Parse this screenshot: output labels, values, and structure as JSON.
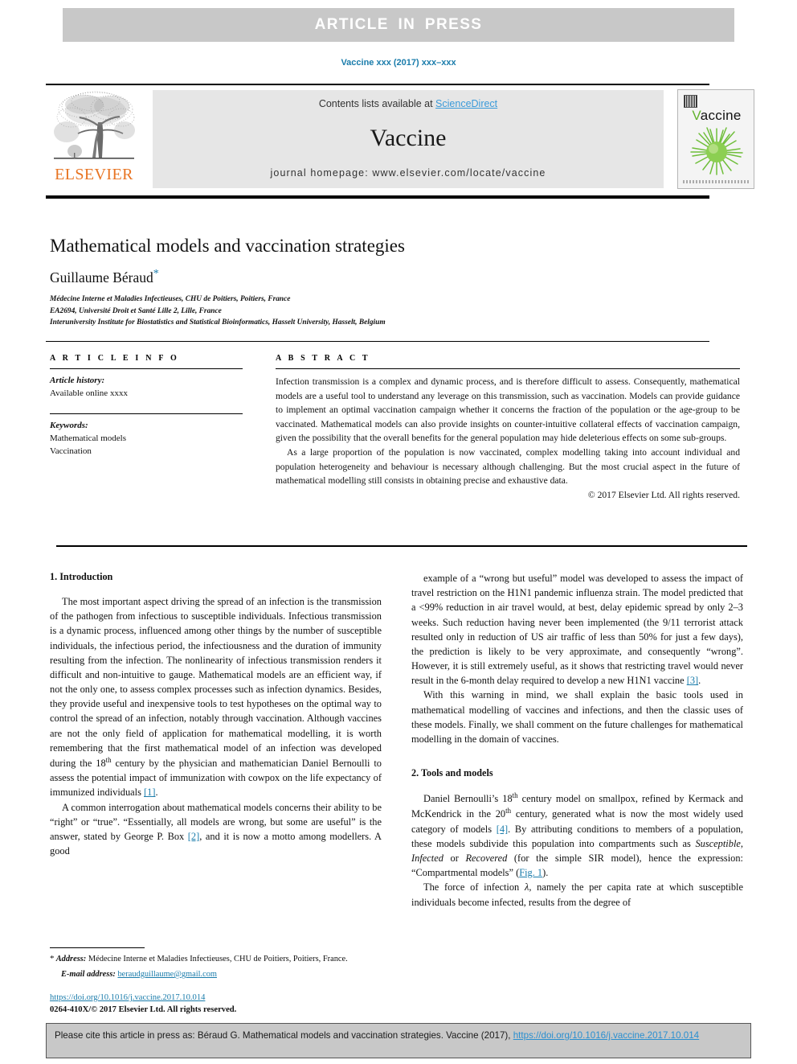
{
  "banner": {
    "label": "ARTICLE IN PRESS"
  },
  "running_head": {
    "text": "Vaccine xxx (2017) xxx–xxx"
  },
  "masthead": {
    "contents_prefix": "Contents lists available at ",
    "sciencedirect": "ScienceDirect",
    "journal_name": "Vaccine",
    "homepage": "journal homepage: www.elsevier.com/locate/vaccine",
    "publisher": "ELSEVIER",
    "cover_title_first": "V",
    "cover_title_rest": "accine"
  },
  "title_block": {
    "title": "Mathematical models and vaccination strategies",
    "author": "Guillaume Béraud",
    "author_marker": "*",
    "affiliations": [
      "Médecine Interne et Maladies Infectieuses, CHU de Poitiers, Poitiers, France",
      "EA2694, Université Droit et Santé Lille 2, Lille, France",
      "Interuniversity Institute for Biostatistics and Statistical Bioinformatics, Hasselt University, Hasselt, Belgium"
    ]
  },
  "article_info": {
    "heading": "A R T I C L E   I N F O",
    "history_label": "Article history:",
    "history_value": "Available online xxxx",
    "keywords_label": "Keywords:",
    "keywords": [
      "Mathematical models",
      "Vaccination"
    ]
  },
  "abstract": {
    "heading": "A B S T R A C T",
    "paragraph_1": "Infection transmission is a complex and dynamic process, and is therefore difficult to assess. Consequently, mathematical models are a useful tool to understand any leverage on this transmission, such as vaccination. Models can provide guidance to implement an optimal vaccination campaign whether it concerns the fraction of the population or the age-group to be vaccinated. Mathematical models can also provide insights on counter-intuitive collateral effects of vaccination campaign, given the possibility that the overall benefits for the general population may hide deleterious effects on some sub-groups.",
    "paragraph_2": "As a large proportion of the population is now vaccinated, complex modelling taking into account individual and population heterogeneity and behaviour is necessary although challenging. But the most crucial aspect in the future of mathematical modelling still consists in obtaining precise and exhaustive data.",
    "copyright": "© 2017 Elsevier Ltd. All rights reserved."
  },
  "body": {
    "left": {
      "heading": "1. Introduction",
      "para_1_a": "The most important aspect driving the spread of an infection is the transmission of the pathogen from infectious to susceptible individuals. Infectious transmission is a dynamic process, influenced among other things by the number of susceptible individuals, the infectious period, the infectiousness and the duration of immunity resulting from the infection. The nonlinearity of infectious transmission renders it difficult and non-intuitive to gauge. Mathematical models are an efficient way, if not the only one, to assess complex processes such as infection dynamics. Besides, they provide useful and inexpensive tools to test hypotheses on the optimal way to control the spread of an infection, notably through vaccination. Although vaccines are not the only field of application for mathematical modelling, it is worth remembering that the first mathematical model of an infection was developed during the 18",
      "para_1_sup": "th",
      "para_1_b": " century by the physician and mathematician Daniel Bernoulli to assess the potential impact of immunization with cowpox on the life expectancy of immunized individuals ",
      "para_1_ref": "[1]",
      "para_1_end": ".",
      "para_2_a": "A common interrogation about mathematical models concerns their ability to be “right” or “true”. “Essentially, all models are wrong, but some are useful” is the answer, stated by George P. Box ",
      "para_2_ref": "[2]",
      "para_2_b": ", and it is now a motto among modellers. A good"
    },
    "right": {
      "para_1": "example of a “wrong but useful” model was developed to assess the impact of travel restriction on the H1N1 pandemic influenza strain. The model predicted that a <99% reduction in air travel would, at best, delay epidemic spread by only 2–3 weeks. Such reduction having never been implemented (the 9/11 terrorist attack resulted only in reduction of US air traffic of less than 50% for just a few days), the prediction is likely to be very approximate, and consequently “wrong”. However, it is still extremely useful, as it shows that restricting travel would never result in the 6-month delay required to develop a new H1N1 vaccine ",
      "para_1_ref": "[3]",
      "para_1_end": ".",
      "para_2": "With this warning in mind, we shall explain the basic tools used in mathematical modelling of vaccines and infections, and then the classic uses of these models. Finally, we shall comment on the future challenges for mathematical modelling in the domain of vaccines.",
      "heading_2": "2. Tools and models",
      "para_3_a": "Daniel Bernoulli’s 18",
      "para_3_sup1": "th",
      "para_3_b": " century model on smallpox, refined by Kermack and McKendrick in the 20",
      "para_3_sup2": "th",
      "para_3_c": " century, generated what is now the most widely used category of models ",
      "para_3_ref": "[4]",
      "para_3_d": ". By attributing conditions to members of a population, these models subdivide this population into compartments such as ",
      "para_3_it1": "Susceptible",
      "para_3_e": ", ",
      "para_3_it2": "Infected",
      "para_3_f": " or ",
      "para_3_it3": "Recovered",
      "para_3_g": " (for the simple SIR model), hence the expression: “Compartmental models” (",
      "para_3_figref": "Fig. 1",
      "para_3_h": ").",
      "para_4_a": "The force of infection ",
      "para_4_lambda": "λ",
      "para_4_b": ", namely the per capita rate at which susceptible individuals become infected, results from the degree of"
    }
  },
  "footnote": {
    "marker": "*",
    "address_label": " Address: ",
    "address_value": "Médecine Interne et Maladies Infectieuses, CHU de Poitiers, Poitiers, France.",
    "email_label": "E-mail address: ",
    "email_value": "beraudguillaume@gmail.com"
  },
  "doi_block": {
    "doi": "https://doi.org/10.1016/j.vaccine.2017.10.014",
    "issn": "0264-410X/© 2017 Elsevier Ltd. All rights reserved."
  },
  "citation_footer": {
    "text_before": "Please cite this article in press as: Béraud G. Mathematical models and vaccination strategies. Vaccine (2017), ",
    "link": "https://doi.org/10.1016/j.vaccine.2017.10.014"
  },
  "colors": {
    "link_blue": "#1a7cab",
    "elsevier_orange": "#e87422",
    "banner_gray": "#c8c8c8",
    "masthead_gray": "#e6e6e6",
    "cover_green": "#63b32e"
  }
}
